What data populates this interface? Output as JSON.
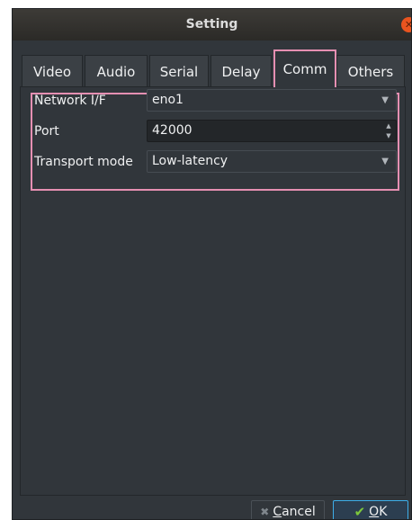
{
  "window": {
    "title": "Setting"
  },
  "tabs": [
    {
      "label": "Video"
    },
    {
      "label": "Audio"
    },
    {
      "label": "Serial"
    },
    {
      "label": "Delay"
    },
    {
      "label": "Comm",
      "active": true
    },
    {
      "label": "Others"
    }
  ],
  "form": {
    "network_label": "Network I/F",
    "network_value": "eno1",
    "port_label": "Port",
    "port_value": "42000",
    "transport_label": "Transport mode",
    "transport_value": "Low-latency"
  },
  "buttons": {
    "cancel_first": "C",
    "cancel_rest": "ancel",
    "ok_first": "O",
    "ok_rest": "K"
  },
  "colors": {
    "accent": "#3daee9",
    "highlight": "#e58fb2",
    "close": "#e9541f",
    "ok_check": "#7dc83c"
  }
}
